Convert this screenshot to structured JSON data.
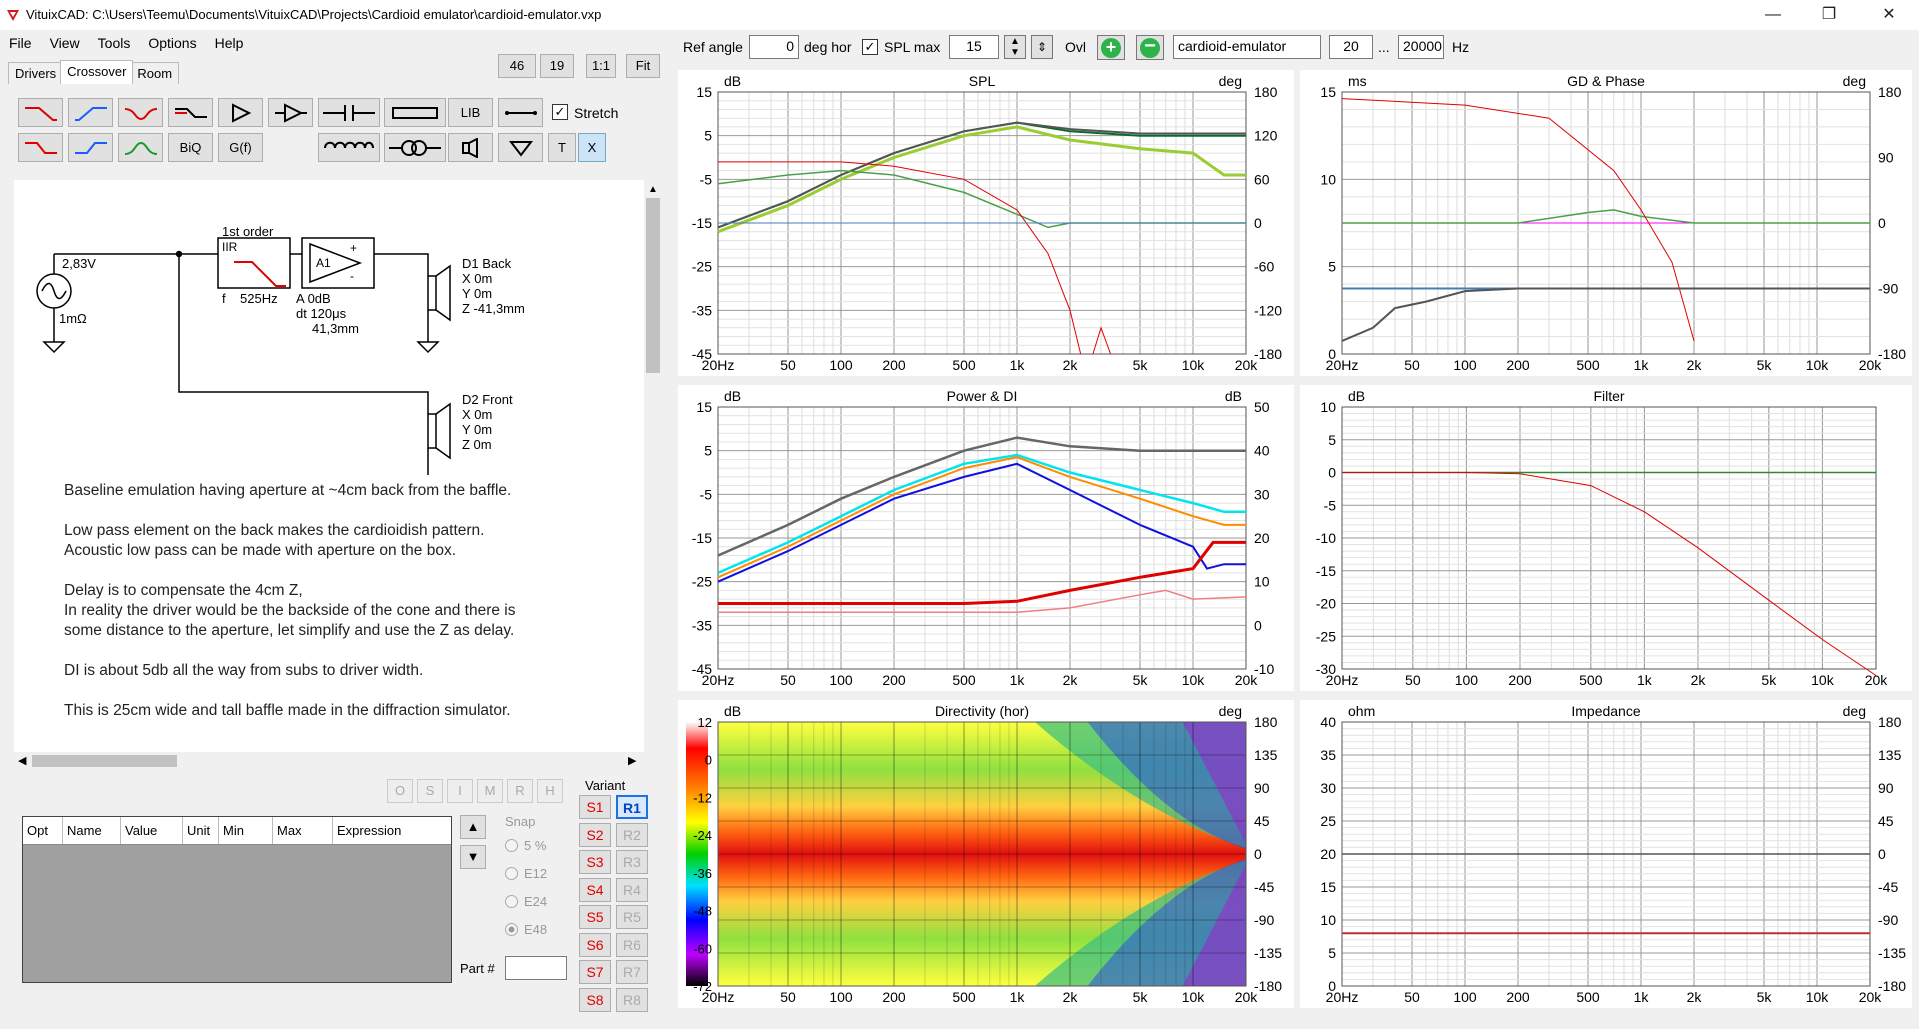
{
  "window": {
    "title": "VituixCAD: C:\\Users\\Teemu\\Documents\\VituixCAD\\Projects\\Cardioid emulator\\cardioid-emulator.vxp"
  },
  "menu": [
    "File",
    "View",
    "Tools",
    "Options",
    "Help"
  ],
  "tabs": [
    "Drivers",
    "Crossover",
    "Room"
  ],
  "top_buttons": [
    "46",
    "19",
    "1:1",
    "Fit"
  ],
  "toolbar": {
    "lib": "LIB",
    "stretch": "Stretch",
    "biq": "BiQ",
    "gf": "G(f)",
    "t": "T",
    "x": "X"
  },
  "schematic": {
    "source_voltage": "2,83V",
    "source_res": "1mΩ",
    "filter_title": "1st order",
    "filter_type": "IIR",
    "filter_f_label": "f",
    "filter_f": "525Hz",
    "amp_label": "A1",
    "amp_plus": "+",
    "amp_minus": "-",
    "amp_gain": "A  0dB",
    "amp_delay": "dt 120μs",
    "amp_dist": "41,3mm",
    "d1": {
      "name": "D1 Back",
      "x": "X 0m",
      "y": "Y 0m",
      "z": "Z -41,3mm"
    },
    "d2": {
      "name": "D2 Front",
      "x": "X 0m",
      "y": "Y 0m",
      "z": "Z 0m"
    },
    "notes": [
      "Baseline emulation having aperture at ~4cm back from the baffle.",
      "Low pass element on the back makes the cardioidish pattern.",
      "Acoustic low pass can be made with aperture on the box.",
      "Delay is to compensate the 4cm Z,",
      "In reality the driver would be the backside of the cone and there is",
      "some distance to the aperture, let simplify and use  the Z as delay.",
      "DI is about 5db all the way from subs to driver width.",
      "This is 25cm wide and tall baffle made in the diffraction simulator."
    ]
  },
  "opt_buttons": [
    "O",
    "S",
    "I",
    "M",
    "R",
    "H"
  ],
  "part_table": {
    "columns": [
      "Opt",
      "Name",
      "Value",
      "Unit",
      "Min",
      "Max",
      "Expression"
    ]
  },
  "snap": {
    "label": "Snap",
    "options": [
      "5 %",
      "E12",
      "E24",
      "E48"
    ]
  },
  "part_no_label": "Part #",
  "variant": {
    "label": "Variant",
    "s": [
      "S1",
      "S2",
      "S3",
      "S4",
      "S5",
      "S6",
      "S7",
      "S8"
    ],
    "r": [
      "R1",
      "R2",
      "R3",
      "R4",
      "R5",
      "R6",
      "R7",
      "R8"
    ]
  },
  "topbar": {
    "ref_angle_label": "Ref angle",
    "ref_angle": "0",
    "deg_hor": "deg hor",
    "spl_max_label": "SPL max",
    "spl_max": "15",
    "ovl": "Ovl",
    "project": "cardioid-emulator",
    "f_min": "20",
    "dots": "...",
    "f_max": "20000",
    "hz": "Hz"
  },
  "freq_ticks": [
    "20Hz",
    "50",
    "100",
    "200",
    "500",
    "1k",
    "2k",
    "5k",
    "10k",
    "20k"
  ],
  "charts": {
    "spl": {
      "title": "SPL",
      "yunit": "dB",
      "y2unit": "deg",
      "y": [
        "15",
        "5",
        "-5",
        "-15",
        "-25",
        "-35",
        "-45"
      ],
      "y2": [
        "180",
        "120",
        "60",
        "0",
        "-60",
        "-120",
        "-180"
      ]
    },
    "gd": {
      "title": "GD & Phase",
      "yunit": "ms",
      "y2unit": "deg",
      "y": [
        "15",
        "10",
        "5",
        "0"
      ],
      "y2": [
        "180",
        "90",
        "0",
        "-90",
        "-180"
      ]
    },
    "power": {
      "title": "Power & DI",
      "yunit": "dB",
      "y2unit": "dB",
      "y": [
        "15",
        "5",
        "-5",
        "-15",
        "-25",
        "-35",
        "-45"
      ],
      "y2": [
        "50",
        "40",
        "30",
        "20",
        "10",
        "0",
        "-10"
      ]
    },
    "filter": {
      "title": "Filter",
      "yunit": "dB",
      "y": [
        "10",
        "5",
        "0",
        "-5",
        "-10",
        "-15",
        "-20",
        "-25",
        "-30"
      ]
    },
    "directivity": {
      "title": "Directivity (hor)",
      "yunit": "dB",
      "y2unit": "deg",
      "scale": [
        "12",
        "0",
        "-12",
        "-24",
        "-36",
        "-48",
        "-60",
        "-72"
      ],
      "y2": [
        "180",
        "135",
        "90",
        "45",
        "0",
        "-45",
        "-90",
        "-135",
        "-180"
      ]
    },
    "impedance": {
      "title": "Impedance",
      "yunit": "ohm",
      "y2unit": "deg",
      "y": [
        "40",
        "35",
        "30",
        "25",
        "20",
        "15",
        "10",
        "5",
        "0"
      ],
      "y2": [
        "180",
        "135",
        "90",
        "45",
        "0",
        "-45",
        "-90",
        "-135",
        "-180"
      ]
    }
  },
  "colors": {
    "accent_red": "#e00000",
    "green_btn": "#2db34a",
    "window_bg": "#f0f0f0"
  }
}
